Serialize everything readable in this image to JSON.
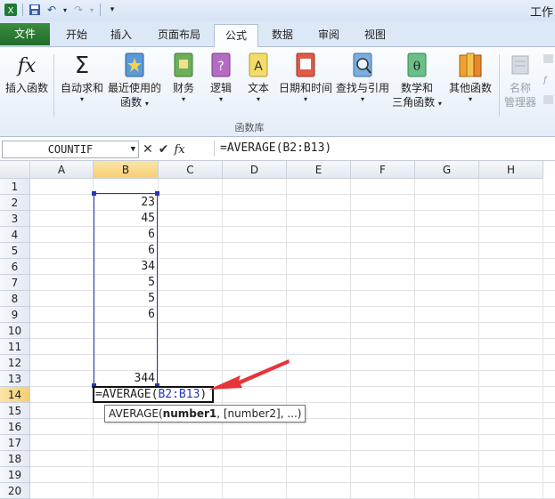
{
  "window": {
    "title_partial": "工作"
  },
  "tabs": {
    "file": "文件",
    "home": "开始",
    "insert": "插入",
    "layout": "页面布局",
    "formulas": "公式",
    "data": "数据",
    "review": "审阅",
    "view": "视图"
  },
  "ribbon": {
    "insert_function": "插入函数",
    "autosum": "自动求和",
    "recent_l1": "最近使用的",
    "recent_l2": "函数",
    "finance": "财务",
    "logical": "逻辑",
    "text": "文本",
    "datetime": "日期和时间",
    "lookup": "查找与引用",
    "math_l1": "数学和",
    "math_l2": "三角函数",
    "more": "其他函数",
    "name_mgr_l1": "名称",
    "name_mgr_l2": "管理器",
    "group_label": "函数库"
  },
  "formula_bar": {
    "name_box": "COUNTIF",
    "formula": "=AVERAGE(B2:B13)"
  },
  "columns": [
    "A",
    "B",
    "C",
    "D",
    "E",
    "F",
    "G",
    "H"
  ],
  "rows": [
    "1",
    "2",
    "3",
    "4",
    "5",
    "6",
    "7",
    "8",
    "9",
    "10",
    "11",
    "12",
    "13",
    "14",
    "15",
    "16",
    "17",
    "18",
    "19",
    "20"
  ],
  "cells_b": {
    "2": "23",
    "3": "45",
    "4": "6",
    "5": "6",
    "6": "34",
    "7": "5",
    "8": "5",
    "9": "6",
    "13": "344"
  },
  "editing": {
    "prefix": "=AVERAGE(",
    "ref": "B2:B13",
    "suffix": ")"
  },
  "tooltip": {
    "fn": "AVERAGE(",
    "arg1": "number1",
    "rest": ", [number2], ...)"
  },
  "colors": {
    "range_border": "#2936b6",
    "arrow": "#e8333a",
    "file_tab": "#2a7a34"
  }
}
